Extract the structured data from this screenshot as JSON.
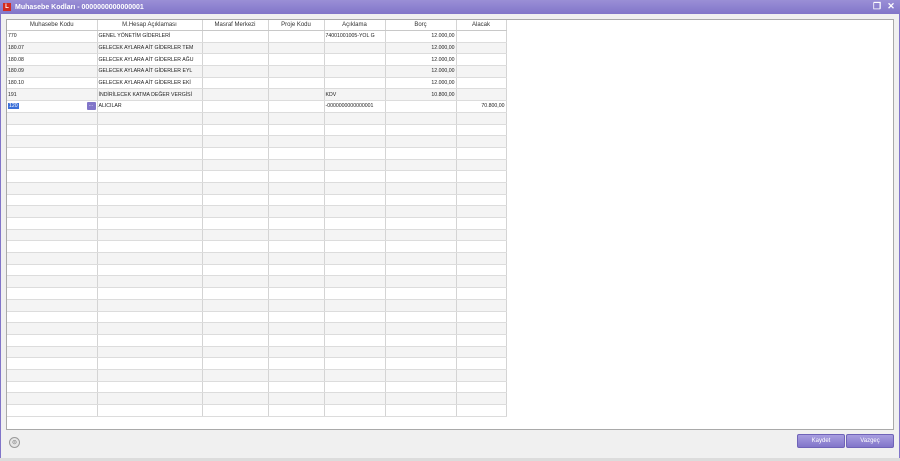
{
  "window": {
    "title": "Muhasebe Kodları - 0000000000000001",
    "app_icon": "L",
    "restore_glyph": "❐",
    "close_glyph": "✕"
  },
  "grid": {
    "columns": [
      "Muhasebe  Kodu",
      "M.Hesap Açıklaması",
      "Masraf Merkezi",
      "Proje Kodu",
      "Açıklama",
      "Borç",
      "Alacak"
    ],
    "rows": [
      [
        "770",
        "GENEL YÖNETİM GİDERLERİ",
        "",
        "",
        "74001001005-YOL G",
        "12.000,00",
        ""
      ],
      [
        "180.07",
        "GELECEK AYLARA AİT GİDERLER TEM",
        "",
        "",
        "",
        "12.000,00",
        ""
      ],
      [
        "180.08",
        "GELECEK AYLARA AİT GİDERLER AĞU",
        "",
        "",
        "",
        "12.000,00",
        ""
      ],
      [
        "180.09",
        "GELECEK AYLARA AİT GİDERLER EYL",
        "",
        "",
        "",
        "12.000,00",
        ""
      ],
      [
        "180.10",
        "GELECEK AYLARA AİT GİDERLER EKİ",
        "",
        "",
        "",
        "12.000,00",
        ""
      ],
      [
        "191",
        "İNDİRİLECEK KATMA DEĞER VERGİSİ",
        "",
        "",
        "KDV",
        "10.800,00",
        ""
      ],
      [
        "120",
        "ALICILAR",
        "",
        "",
        "-0000000000000001",
        "",
        "70.800,00"
      ]
    ],
    "empty_rows": 26,
    "lookup_button": "..."
  },
  "footer": {
    "save_label": "Kaydet",
    "cancel_label": "Vazgeç",
    "info_icon": "⊜"
  }
}
